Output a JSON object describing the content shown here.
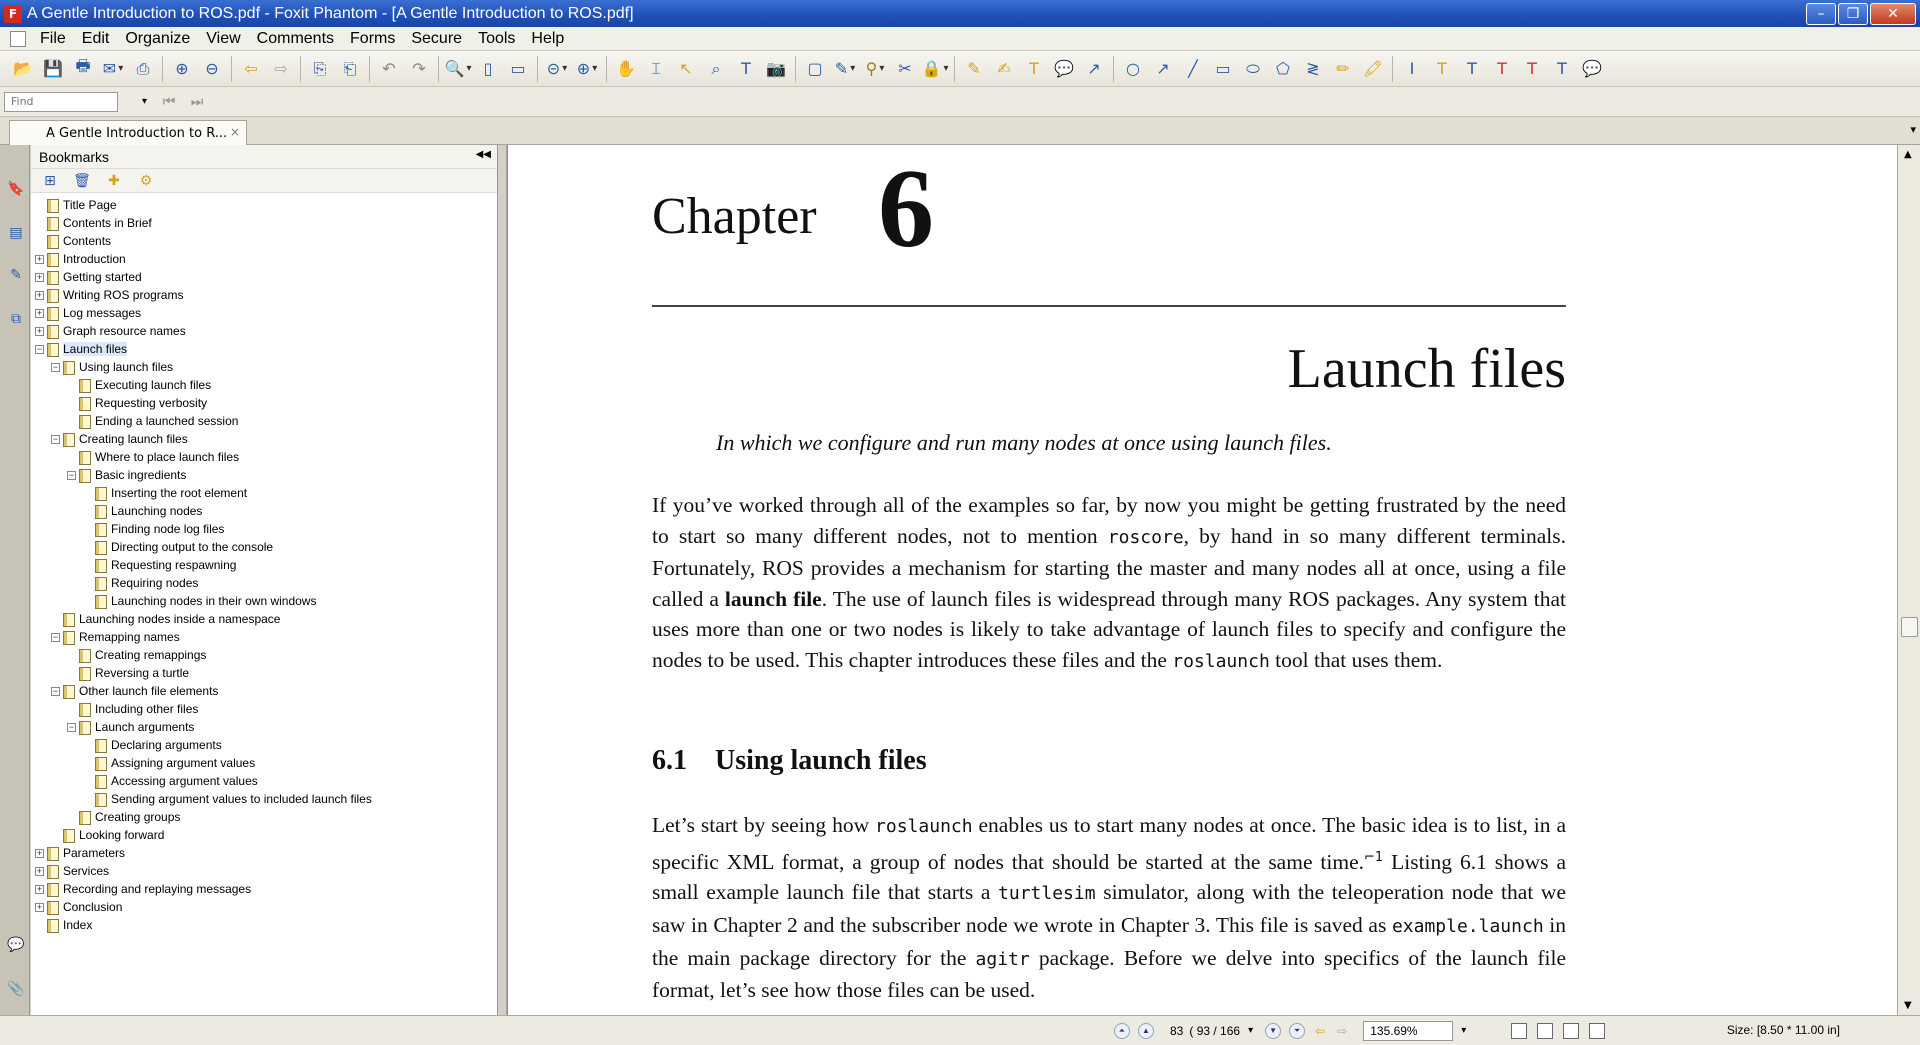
{
  "window": {
    "title": "A Gentle Introduction to ROS.pdf - Foxit Phantom - [A Gentle Introduction to ROS.pdf]",
    "minimize": "–",
    "maximize": "❐",
    "close": "✕"
  },
  "menu": {
    "items": [
      "File",
      "Edit",
      "Organize",
      "View",
      "Comments",
      "Forms",
      "Secure",
      "Tools",
      "Help"
    ]
  },
  "find": {
    "placeholder": "Find"
  },
  "tab": {
    "label": "A Gentle Introduction to R...",
    "close": "×"
  },
  "bookmarks": {
    "header": "Bookmarks",
    "items": [
      {
        "label": "Title Page",
        "level": 0,
        "expander": ""
      },
      {
        "label": "Contents in Brief",
        "level": 0,
        "expander": ""
      },
      {
        "label": "Contents",
        "level": 0,
        "expander": ""
      },
      {
        "label": "Introduction",
        "level": 0,
        "expander": "+"
      },
      {
        "label": "Getting started",
        "level": 0,
        "expander": "+"
      },
      {
        "label": "Writing ROS programs",
        "level": 0,
        "expander": "+"
      },
      {
        "label": "Log messages",
        "level": 0,
        "expander": "+"
      },
      {
        "label": "Graph resource names",
        "level": 0,
        "expander": "+"
      },
      {
        "label": "Launch files",
        "level": 0,
        "expander": "−",
        "selected": true
      },
      {
        "label": "Using launch files",
        "level": 1,
        "expander": "−"
      },
      {
        "label": "Executing launch files",
        "level": 2,
        "expander": ""
      },
      {
        "label": "Requesting verbosity",
        "level": 2,
        "expander": ""
      },
      {
        "label": "Ending a launched session",
        "level": 2,
        "expander": ""
      },
      {
        "label": "Creating launch files",
        "level": 1,
        "expander": "−"
      },
      {
        "label": "Where to place launch files",
        "level": 2,
        "expander": ""
      },
      {
        "label": "Basic ingredients",
        "level": 2,
        "expander": "−"
      },
      {
        "label": "Inserting the root element",
        "level": 3,
        "expander": ""
      },
      {
        "label": "Launching nodes",
        "level": 3,
        "expander": ""
      },
      {
        "label": "Finding node log files",
        "level": 3,
        "expander": ""
      },
      {
        "label": "Directing output to the console",
        "level": 3,
        "expander": ""
      },
      {
        "label": "Requesting respawning",
        "level": 3,
        "expander": ""
      },
      {
        "label": "Requiring nodes",
        "level": 3,
        "expander": ""
      },
      {
        "label": "Launching nodes in their own windows",
        "level": 3,
        "expander": ""
      },
      {
        "label": "Launching nodes inside a namespace",
        "level": 1,
        "expander": ""
      },
      {
        "label": "Remapping names",
        "level": 1,
        "expander": "−"
      },
      {
        "label": "Creating remappings",
        "level": 2,
        "expander": ""
      },
      {
        "label": "Reversing a turtle",
        "level": 2,
        "expander": ""
      },
      {
        "label": "Other launch file elements",
        "level": 1,
        "expander": "−"
      },
      {
        "label": "Including other files",
        "level": 2,
        "expander": ""
      },
      {
        "label": "Launch arguments",
        "level": 2,
        "expander": "−"
      },
      {
        "label": "Declaring arguments",
        "level": 3,
        "expander": ""
      },
      {
        "label": "Assigning argument values",
        "level": 3,
        "expander": ""
      },
      {
        "label": "Accessing argument values",
        "level": 3,
        "expander": ""
      },
      {
        "label": "Sending argument values to included launch files",
        "level": 3,
        "expander": ""
      },
      {
        "label": "Creating groups",
        "level": 2,
        "expander": ""
      },
      {
        "label": "Looking forward",
        "level": 1,
        "expander": ""
      },
      {
        "label": "Parameters",
        "level": 0,
        "expander": "+"
      },
      {
        "label": "Services",
        "level": 0,
        "expander": "+"
      },
      {
        "label": "Recording and replaying messages",
        "level": 0,
        "expander": "+"
      },
      {
        "label": "Conclusion",
        "level": 0,
        "expander": "+"
      },
      {
        "label": "Index",
        "level": 0,
        "expander": ""
      }
    ]
  },
  "document": {
    "chapter_word": "Chapter",
    "chapter_number": "6",
    "chapter_title": "Launch files",
    "chapter_subtitle": "In which we configure and run many nodes at once using launch files.",
    "para1": {
      "t1": "If you’ve worked through all of the examples so far, by now you might be getting frustrated by the need to start so many different nodes, not to mention ",
      "c1": "roscore",
      "t2": ", by hand in so many different terminals. Fortunately, ROS provides a mechanism for starting the master and many nodes all at once, using a file called a ",
      "b1": "launch file",
      "t3": ". The use of launch files is widespread through many ROS packages. Any system that uses more than one or two nodes is likely to take advantage of launch files to specify and configure the nodes to be used. This chapter introduces these files and the ",
      "c2": "roslaunch",
      "t4": " tool that uses them."
    },
    "section": {
      "number": "6.1",
      "title": "Using launch files"
    },
    "para2": {
      "t1": "Let’s start by seeing how ",
      "c1": "roslaunch",
      "t2": " enables us to start many nodes at once. The basic idea is to list, in a specific XML format, a group of nodes that should be started at the same time.",
      "fn": "⌐1",
      "t3": " Listing 6.1 shows a small example launch file that starts a ",
      "c2": "turtlesim",
      "t4": " simulator, along with the teleoperation node that we saw in Chapter 2 and the subscriber node we wrote in Chapter 3. This file is saved as ",
      "c3": "example.launch",
      "t5": " in the main package directory for the ",
      "c4": "agitr",
      "t6": " package. Before we delve into specifics of the launch file format, let’s see how those files can be used."
    }
  },
  "status": {
    "page_current": "83",
    "page_label": "( 93 / 166",
    "zoom": "135.69%",
    "size": "Size: [8.50 * 11.00 in]"
  },
  "icons": {
    "toolbar": [
      "open-icon",
      "save-icon",
      "print-icon",
      "email-icon",
      "scan-icon",
      "scroll-up-icon",
      "scroll-down-icon",
      "back-icon",
      "forward-icon",
      "insert-page-icon",
      "extract-page-icon",
      "undo-icon",
      "redo-icon",
      "zoom-icon",
      "fit-page-icon",
      "fit-width-icon",
      "zoom-out-icon",
      "zoom-in-icon",
      "hand-icon",
      "select-text-icon",
      "select-annotation-icon",
      "find-icon",
      "typewriter-icon",
      "snapshot-icon",
      "form-icon",
      "edit-icon",
      "stamp-icon",
      "attach-icon",
      "lock-icon",
      "note-icon",
      "highlight-icon",
      "textbox-icon",
      "callout-icon",
      "arrow-icon",
      "circle-icon",
      "line-icon",
      "rect-icon",
      "ellipse-icon",
      "polygon-icon",
      "pencil-icon",
      "marker-icon",
      "underline-icon",
      "strikeout-icon",
      "replace-icon",
      "comment-icon"
    ]
  }
}
